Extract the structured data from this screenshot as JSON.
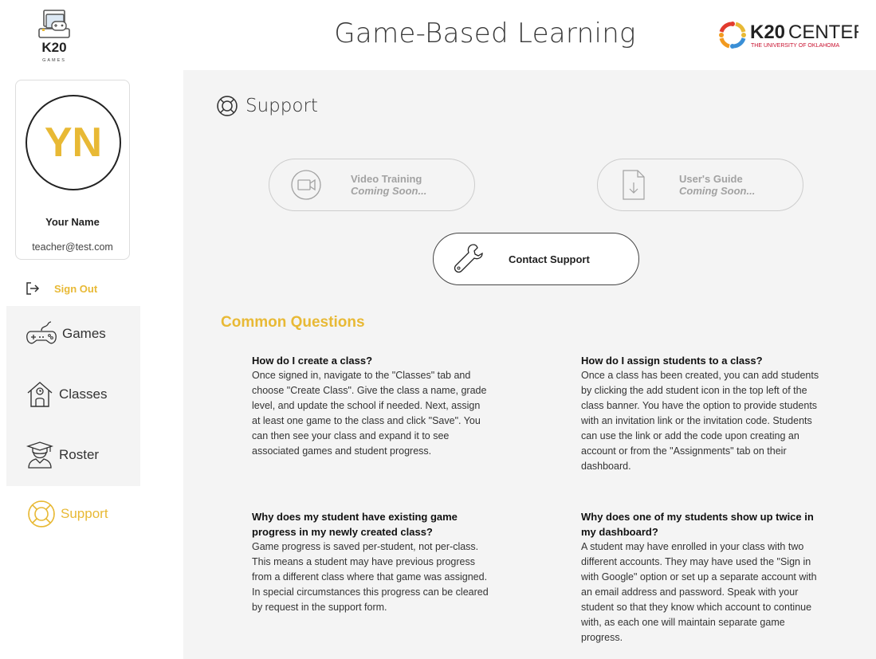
{
  "header": {
    "title": "Game-Based Learning",
    "left_logo": {
      "text": "K20",
      "sub": "GAMES"
    },
    "right_logo": {
      "bold": "K20",
      "light": "CENTER",
      "sub": "THE UNIVERSITY OF OKLAHOMA"
    }
  },
  "profile": {
    "initials": "YN",
    "name": "Your Name",
    "email": "teacher@test.com"
  },
  "sidebar": {
    "sign_out": "Sign Out",
    "items": [
      {
        "label": "Games",
        "icon": "gamepad-icon"
      },
      {
        "label": "Classes",
        "icon": "schoolhouse-icon"
      },
      {
        "label": "Roster",
        "icon": "graduate-icon"
      },
      {
        "label": "Support",
        "icon": "lifebuoy-icon",
        "active": true
      }
    ]
  },
  "page": {
    "title": "Support",
    "video_training": {
      "label": "Video Training",
      "status": "Coming Soon..."
    },
    "users_guide": {
      "label": "User's Guide",
      "status": "Coming Soon..."
    },
    "contact_support": {
      "label": "Contact Support"
    },
    "common_questions_heading": "Common Questions",
    "questions": [
      {
        "q": "How do I create a class?",
        "a": "Once signed in, navigate to the \"Classes\" tab and choose \"Create Class\". Give the class a name, grade level, and update the school if needed. Next, assign at least one game to the class and click \"Save\". You can then see your class and expand it to see associated games and student progress."
      },
      {
        "q": "How do I assign students to a class?",
        "a": "Once a class has been created, you can add students by clicking the add student icon in the top left of the class banner. You have the option to provide students with an invitation link or the invitation code. Students can use the link or add the code upon creating an account or from the \"Assignments\" tab on their dashboard."
      },
      {
        "q": "Why does my student have existing game progress in my newly created class?",
        "a": "Game progress is saved per-student, not per-class. This means a student may have previous progress from a different class where that game was assigned. In special circumstances this progress can be cleared by request in the support form."
      },
      {
        "q": "Why does one of my students show up twice in my dashboard?",
        "a": "A student may have enrolled in your class with two different accounts. They may have used the \"Sign in with Google\" option or set up a separate account with an email address and password. Speak with your student so that they know which account to continue with, as each one will maintain separate game progress."
      }
    ]
  },
  "colors": {
    "accent": "#e8b935",
    "main_bg": "#f4f4f4",
    "text": "#333333"
  }
}
